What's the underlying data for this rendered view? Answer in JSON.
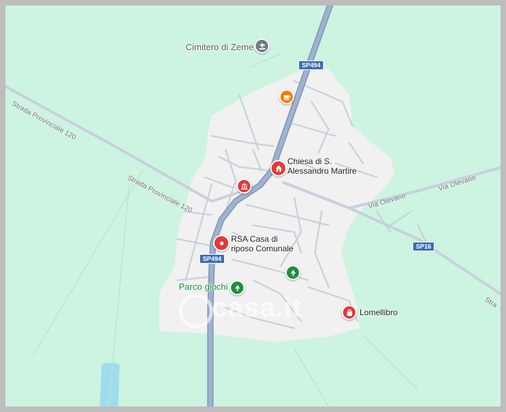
{
  "map": {
    "colors": {
      "background": "#cdf4e0",
      "town": "#f1f1f1",
      "main_road": "#8ea6c3",
      "minor_road": "#c7d0dc",
      "water": "#9fdcef",
      "pin_red": "#e53935",
      "pin_orange": "#f57c00",
      "pin_green": "#1e8e3e",
      "pin_grey": "#6f7a85"
    },
    "places": [
      {
        "id": "cimitero",
        "label": "Cimitero di Zeme",
        "icon": "cemetery-icon"
      },
      {
        "id": "chiesa",
        "label_line1": "Chiesa di S.",
        "label_line2": "Alessandro Martire",
        "icon": "church-icon"
      },
      {
        "id": "rsa",
        "label_line1": "RSA Casa di",
        "label_line2": "riposo Comunale",
        "icon": "location-pin-icon"
      },
      {
        "id": "parco",
        "label": "Parco giochi",
        "icon": "tree-icon"
      },
      {
        "id": "lomellibro",
        "label": "Lomellibro",
        "icon": "shopping-bag-icon"
      }
    ],
    "unlabeled_pois": [
      {
        "id": "cafe",
        "icon": "cafe-icon"
      },
      {
        "id": "townhall",
        "icon": "town-hall-icon"
      },
      {
        "id": "park2",
        "icon": "tree-icon"
      }
    ],
    "roads": {
      "sp494_top": "SP494",
      "sp494_bottom": "SP494",
      "sp16": "SP16",
      "strada_provinciale_1": "Strada Provinciale 120",
      "strada_provinciale_2": "Strada Provinciale 120",
      "via_olevano_1": "Via Olevano",
      "via_olevano_2": "Via Olevano",
      "edge_label": "Stra"
    },
    "watermark": "casa.it"
  }
}
